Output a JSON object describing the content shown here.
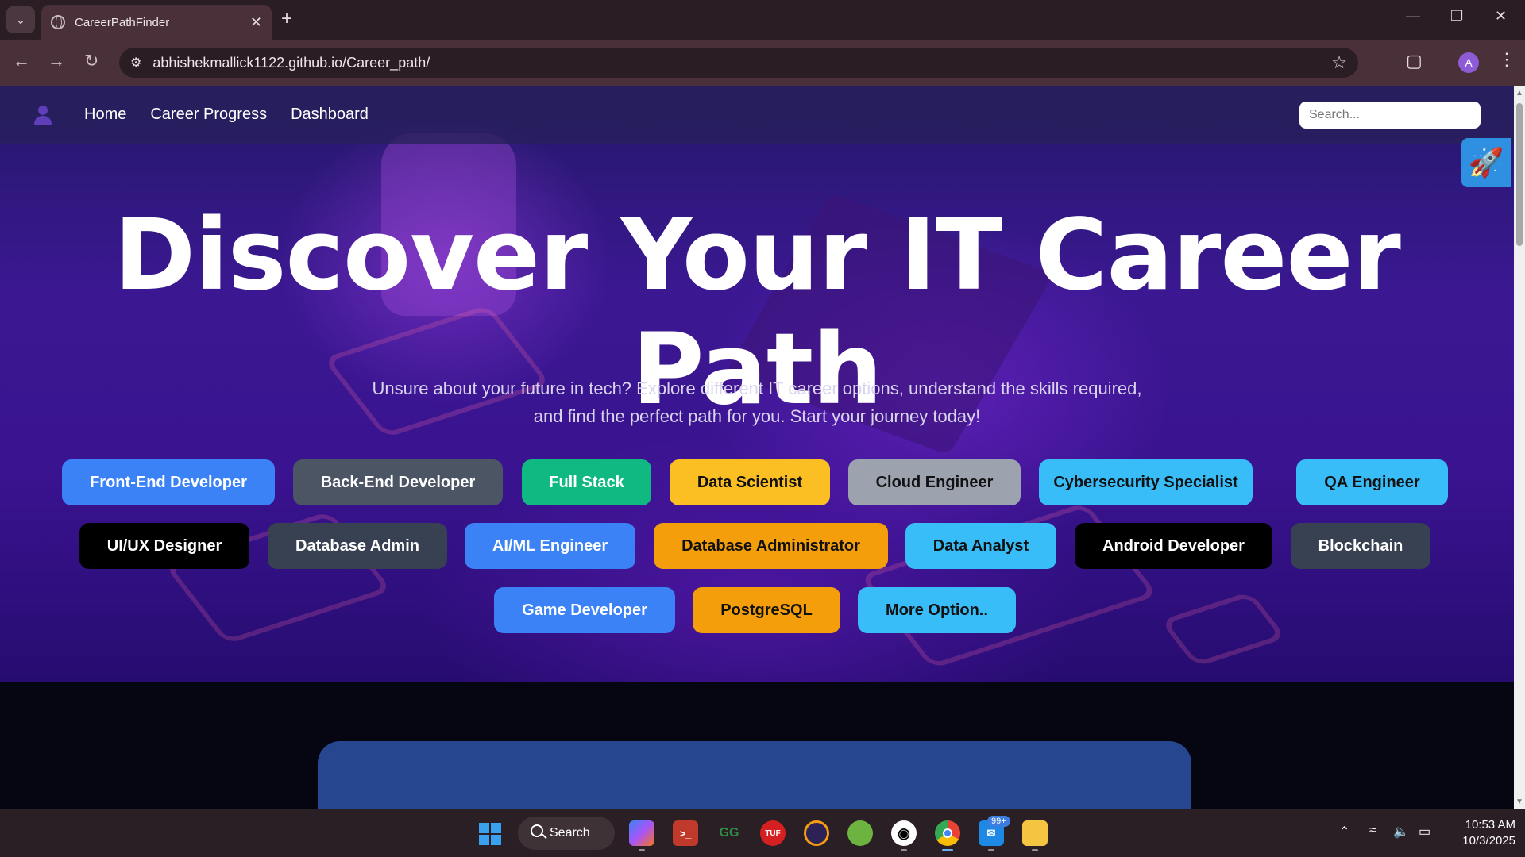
{
  "browser": {
    "tab_title": "CareerPathFinder",
    "url": "abhishekmallick1122.github.io/Career_path/",
    "profile_initial": "A"
  },
  "navbar": {
    "links": [
      "Home",
      "Career Progress",
      "Dashboard"
    ],
    "search_placeholder": "Search..."
  },
  "hero": {
    "title": "Discover Your IT Career Path",
    "subtitle": "Unsure about your future in tech? Explore different IT career options, understand the skills required, and find the perfect path for you. Start your journey today!"
  },
  "career_buttons": [
    {
      "label": "Front-End Developer",
      "color": "#3b82f6",
      "text_color": "#ffffff"
    },
    {
      "label": "Back-End Developer",
      "color": "#4b5563",
      "text_color": "#ffffff"
    },
    {
      "label": "Full Stack",
      "color": "#10b981",
      "text_color": "#ffffff"
    },
    {
      "label": "Data Scientist",
      "color": "#fbbf24",
      "text_color": "#111111"
    },
    {
      "label": "Cloud Engineer",
      "color": "#9ca3af",
      "text_color": "#111111"
    },
    {
      "label": "Cybersecurity Specialist",
      "color": "#38bdf8",
      "text_color": "#111111"
    },
    {
      "label": "QA Engineer",
      "color": "#38bdf8",
      "text_color": "#111111"
    },
    {
      "label": "UI/UX Designer",
      "color": "#000000",
      "text_color": "#ffffff"
    },
    {
      "label": "Database Admin",
      "color": "#374151",
      "text_color": "#ffffff"
    },
    {
      "label": "AI/ML Engineer",
      "color": "#3b82f6",
      "text_color": "#ffffff"
    },
    {
      "label": "Database Administrator",
      "color": "#f59e0b",
      "text_color": "#111111"
    },
    {
      "label": "Data Analyst",
      "color": "#38bdf8",
      "text_color": "#111111"
    },
    {
      "label": "Android Developer",
      "color": "#000000",
      "text_color": "#ffffff"
    },
    {
      "label": "Blockchain",
      "color": "#374151",
      "text_color": "#ffffff"
    },
    {
      "label": "Game Developer",
      "color": "#3b82f6",
      "text_color": "#ffffff"
    },
    {
      "label": "PostgreSQL",
      "color": "#f59e0b",
      "text_color": "#111111"
    },
    {
      "label": "More Option..",
      "color": "#38bdf8",
      "text_color": "#111111"
    }
  ],
  "taskbar": {
    "search_label": "Search",
    "notification_badge": "99+",
    "time": "10:53 AM",
    "date": "10/3/2025"
  }
}
